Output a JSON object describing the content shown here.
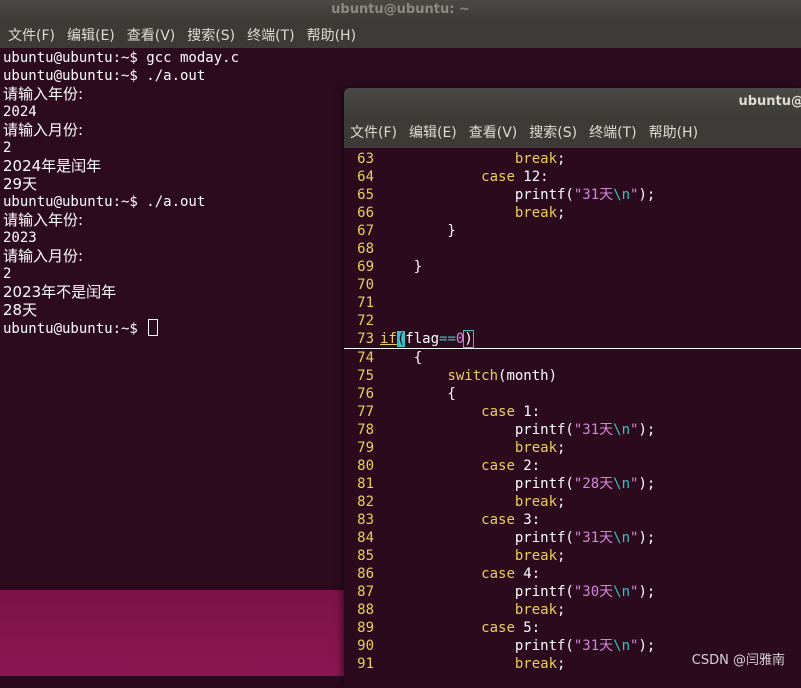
{
  "back_window": {
    "title": "ubuntu@ubuntu: ~",
    "menu": [
      "文件(F)",
      "编辑(E)",
      "查看(V)",
      "搜索(S)",
      "终端(T)",
      "帮助(H)"
    ],
    "lines": [
      "ubuntu@ubuntu:~$ gcc moday.c",
      "ubuntu@ubuntu:~$ ./a.out",
      "请输入年份:",
      "2024",
      "请输入月份:",
      "2",
      "2024年是闰年",
      "29天",
      "ubuntu@ubuntu:~$ ./a.out",
      "请输入年份:",
      "2023",
      "请输入月份:",
      "2",
      "2023年不是闰年",
      "28天",
      "ubuntu@ubuntu:~$ "
    ]
  },
  "front_window": {
    "title": "ubuntu@",
    "menu": [
      "文件(F)",
      "编辑(E)",
      "查看(V)",
      "搜索(S)",
      "终端(T)",
      "帮助(H)"
    ],
    "code": [
      {
        "n": "63",
        "text": "                break;"
      },
      {
        "n": "64",
        "text": "            case 12:"
      },
      {
        "n": "65",
        "text": "                printf(\"31天\\n\");"
      },
      {
        "n": "66",
        "text": "                break;"
      },
      {
        "n": "67",
        "text": "        }"
      },
      {
        "n": "68",
        "text": ""
      },
      {
        "n": "69",
        "text": "    }"
      },
      {
        "n": "70",
        "text": ""
      },
      {
        "n": "71",
        "text": ""
      },
      {
        "n": "72",
        "text": ""
      },
      {
        "n": "73",
        "text": "if(flag==0)"
      },
      {
        "n": "74",
        "text": "    {"
      },
      {
        "n": "75",
        "text": "        switch(month)"
      },
      {
        "n": "76",
        "text": "        {"
      },
      {
        "n": "77",
        "text": "            case 1:"
      },
      {
        "n": "78",
        "text": "                printf(\"31天\\n\");"
      },
      {
        "n": "79",
        "text": "                break;"
      },
      {
        "n": "80",
        "text": "            case 2:"
      },
      {
        "n": "81",
        "text": "                printf(\"28天\\n\");"
      },
      {
        "n": "82",
        "text": "                break;"
      },
      {
        "n": "83",
        "text": "            case 3:"
      },
      {
        "n": "84",
        "text": "                printf(\"31天\\n\");"
      },
      {
        "n": "85",
        "text": "                break;"
      },
      {
        "n": "86",
        "text": "            case 4:"
      },
      {
        "n": "87",
        "text": "                printf(\"30天\\n\");"
      },
      {
        "n": "88",
        "text": "                break;"
      },
      {
        "n": "89",
        "text": "            case 5:"
      },
      {
        "n": "90",
        "text": "                printf(\"31天\\n\");"
      },
      {
        "n": "91",
        "text": "                break;"
      }
    ]
  },
  "watermark": "CSDN @闫雅南",
  "colors": {
    "keyword": "#e9d05a",
    "string": "#d387d9",
    "operator": "#36c2c2"
  }
}
